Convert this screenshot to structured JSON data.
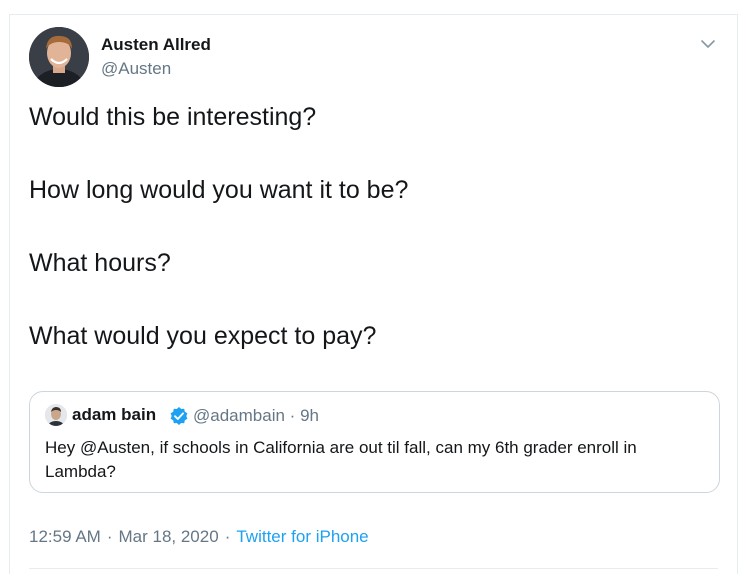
{
  "author": {
    "name": "Austen Allred",
    "handle": "@Austen"
  },
  "tweet": {
    "lines": [
      "Would this be interesting?",
      "How long would you want it to be?",
      "What hours?",
      "What would you expect to pay?"
    ]
  },
  "quoted_tweet": {
    "name": "adam bain",
    "handle": "@adambain",
    "time": "9h",
    "separator": "·",
    "text": "Hey @Austen, if schools in California are out til fall, can my 6th grader enroll in Lambda?"
  },
  "footer": {
    "time": "12:59 AM",
    "date": "Mar 18, 2020",
    "separator": "·",
    "source": "Twitter for iPhone"
  },
  "colors": {
    "accent": "#1da1f2",
    "secondary_text": "#657786",
    "border": "#ccd6dd"
  },
  "icons": {
    "menu": "chevron-down-icon",
    "verified": "verified-badge-icon"
  }
}
